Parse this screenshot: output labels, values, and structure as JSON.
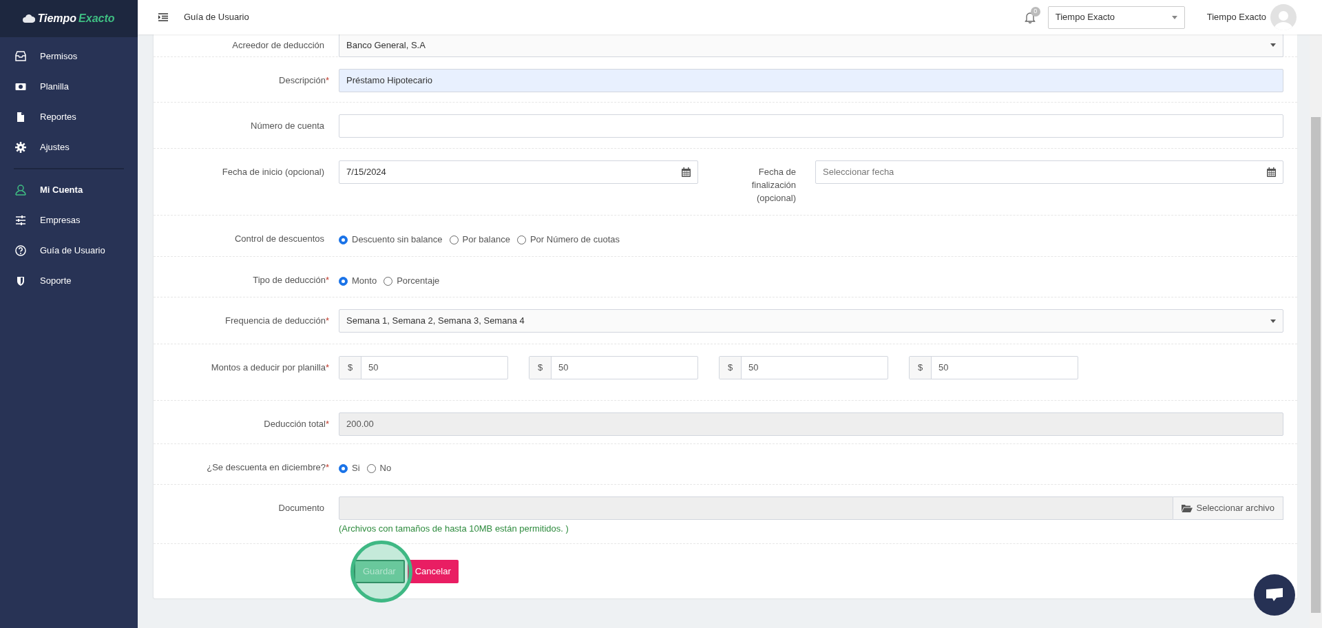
{
  "app": {
    "logo_prefix": "Tiempo",
    "logo_suffix": "Exacto"
  },
  "sidebar": {
    "groups": [
      [
        {
          "label": "Permisos",
          "selected": false
        },
        {
          "label": "Planilla",
          "selected": false
        },
        {
          "label": "Reportes",
          "selected": false
        },
        {
          "label": "Ajustes",
          "selected": false
        }
      ],
      [
        {
          "label": "Mi Cuenta",
          "selected": true
        },
        {
          "label": "Empresas",
          "selected": false
        },
        {
          "label": "Guía de Usuario",
          "selected": false
        },
        {
          "label": "Soporte",
          "selected": false
        }
      ]
    ]
  },
  "header": {
    "page_title": "Guía de Usuario",
    "notification_count": "0",
    "company_select": "Tiempo Exacto",
    "user_name": "Tiempo Exacto"
  },
  "form": {
    "rows": [
      {
        "kind": "select",
        "label": "Acreedor de deducción",
        "value": "Banco General, S.A"
      },
      {
        "kind": "text",
        "label": "Descripción",
        "marker": "*",
        "value": "Préstamo Hipotecario",
        "highlighted": true
      },
      {
        "kind": "text",
        "label": "Número de cuenta",
        "highlighted": false
      },
      {
        "kind": "dates",
        "label": "Fecha de inicio (opcional)",
        "value": "7/15/2024",
        "end_label": "Fecha de finalización (opcional)",
        "end_placeholder": "Seleccionar fecha"
      },
      {
        "kind": "radio",
        "label": "Control de descuentos",
        "options": [
          {
            "label": "Descuento sin balance",
            "selected": true
          },
          {
            "label": "Por balance",
            "selected": false
          },
          {
            "label": "Por Número de cuotas",
            "selected": false
          }
        ]
      },
      {
        "kind": "radio",
        "label": "Tipo de deducción",
        "marker": "*",
        "options": [
          {
            "label": "Monto",
            "selected": true
          },
          {
            "label": "Porcentaje",
            "selected": false
          }
        ]
      },
      {
        "kind": "select",
        "label": "Frequencia de deducción",
        "marker": "*",
        "value": "Semana 1, Semana 2, Semana 3, Semana 4"
      },
      {
        "kind": "amounts",
        "label": "Montos a deducir por planilla",
        "marker": "*",
        "amounts": [
          {
            "prefix": "$",
            "value": "50"
          },
          {
            "prefix": "$",
            "value": "50"
          },
          {
            "prefix": "$",
            "value": "50"
          },
          {
            "prefix": "$",
            "value": "50"
          }
        ]
      },
      {
        "kind": "readonly",
        "label": "Deducción total",
        "marker": "*",
        "value": "200.00"
      },
      {
        "kind": "radio",
        "label": "¿Se descuenta en diciembre?",
        "marker": "*",
        "options": [
          {
            "label": "Si",
            "selected": true
          },
          {
            "label": "No",
            "selected": false
          }
        ]
      },
      {
        "kind": "file",
        "label": "Documento",
        "button": "Seleccionar archivo",
        "help": "(Archivos con tamaños de hasta 10MB están permitidos. )"
      }
    ],
    "actions": [
      {
        "label": "Guardar",
        "kind": "save"
      },
      {
        "label": "Cancelar",
        "kind": "cancel"
      }
    ]
  }
}
